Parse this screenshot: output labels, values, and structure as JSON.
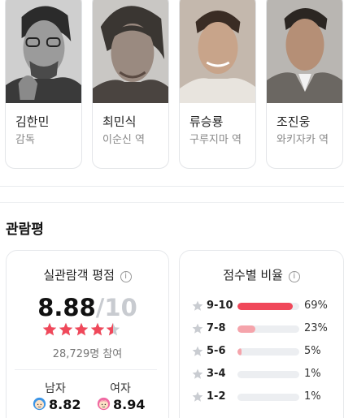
{
  "cast": [
    {
      "name": "김한민",
      "role": "감독"
    },
    {
      "name": "최민식",
      "role": "이순신 역"
    },
    {
      "name": "류승룡",
      "role": "구루지마 역"
    },
    {
      "name": "조진웅",
      "role": "와키자카 역"
    }
  ],
  "reviews": {
    "title": "관람평",
    "audience": {
      "title": "실관람객 평점",
      "info_icon": "info-icon",
      "score": "8.88",
      "slash": "/",
      "max": "10",
      "stars": 4.5,
      "participants": "28,729명 참여",
      "male_label": "남자",
      "male_score": "8.82",
      "female_label": "여자",
      "female_score": "8.94"
    },
    "distribution": {
      "title": "점수별 비율",
      "rows": [
        {
          "label": "9-10",
          "percent": "69%",
          "value": 69,
          "color": "#f0485a"
        },
        {
          "label": "7-8",
          "percent": "23%",
          "value": 23,
          "color": "#f5a4ab"
        },
        {
          "label": "5-6",
          "percent": "5%",
          "value": 5,
          "color": "#f5a4ab"
        },
        {
          "label": "3-4",
          "percent": "1%",
          "value": 1,
          "color": "#f5a4ab"
        },
        {
          "label": "1-2",
          "percent": "1%",
          "value": 1,
          "color": "#f5a4ab"
        }
      ]
    }
  },
  "colors": {
    "star_active": "#f0485a",
    "star_inactive": "#c9ccd1",
    "male_face": "#3d95e6",
    "female_face": "#f06aa3"
  }
}
